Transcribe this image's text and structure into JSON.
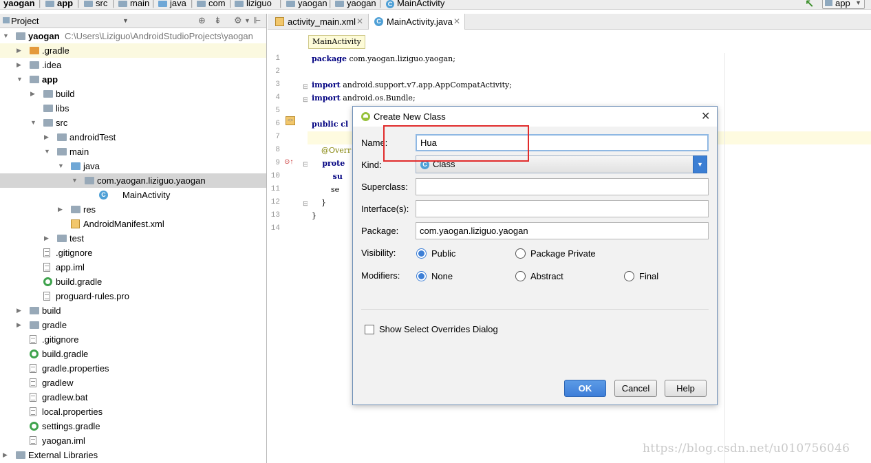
{
  "breadcrumb": {
    "items": [
      "yaogan",
      "app",
      "src",
      "main",
      "java",
      "com",
      "liziguo",
      "yaogan",
      "MainActivity"
    ],
    "run_config": "app"
  },
  "project_panel": {
    "title": "Project",
    "tree": [
      {
        "label": "yaogan",
        "path": "C:\\Users\\Liziguo\\AndroidStudioProjects\\yaogan",
        "depth": 0,
        "icon": "folder-icon",
        "expanded": true,
        "bold": true
      },
      {
        "label": ".gradle",
        "depth": 1,
        "icon": "orange-folder-icon",
        "expanded": false
      },
      {
        "label": ".idea",
        "depth": 1,
        "icon": "folder-icon",
        "expanded": false
      },
      {
        "label": "app",
        "depth": 1,
        "icon": "module-folder-icon",
        "expanded": true,
        "bold": true
      },
      {
        "label": "build",
        "depth": 2,
        "icon": "folder-icon",
        "expanded": false
      },
      {
        "label": "libs",
        "depth": 2,
        "icon": "folder-icon"
      },
      {
        "label": "src",
        "depth": 2,
        "icon": "folder-icon",
        "expanded": true
      },
      {
        "label": "androidTest",
        "depth": 3,
        "icon": "folder-icon",
        "expanded": false
      },
      {
        "label": "main",
        "depth": 3,
        "icon": "folder-icon",
        "expanded": true
      },
      {
        "label": "java",
        "depth": 4,
        "icon": "blue-folder-icon",
        "expanded": true
      },
      {
        "label": "com.yaogan.liziguo.yaogan",
        "depth": 5,
        "icon": "package-icon",
        "expanded": true,
        "selected": true
      },
      {
        "label": "MainActivity",
        "depth": 6,
        "icon": "class-icon"
      },
      {
        "label": "res",
        "depth": 4,
        "icon": "folder-icon",
        "expanded": false
      },
      {
        "label": "AndroidManifest.xml",
        "depth": 4,
        "icon": "xml-file-icon"
      },
      {
        "label": "test",
        "depth": 3,
        "icon": "folder-icon",
        "expanded": false
      },
      {
        "label": ".gitignore",
        "depth": 2,
        "icon": "file-icon"
      },
      {
        "label": "app.iml",
        "depth": 2,
        "icon": "file-icon"
      },
      {
        "label": "build.gradle",
        "depth": 2,
        "icon": "gradle-icon"
      },
      {
        "label": "proguard-rules.pro",
        "depth": 2,
        "icon": "file-icon"
      },
      {
        "label": "build",
        "depth": 1,
        "icon": "folder-icon",
        "expanded": false
      },
      {
        "label": "gradle",
        "depth": 1,
        "icon": "folder-icon",
        "expanded": false
      },
      {
        "label": ".gitignore",
        "depth": 1,
        "icon": "file-icon"
      },
      {
        "label": "build.gradle",
        "depth": 1,
        "icon": "gradle-icon"
      },
      {
        "label": "gradle.properties",
        "depth": 1,
        "icon": "file-icon"
      },
      {
        "label": "gradlew",
        "depth": 1,
        "icon": "file-icon"
      },
      {
        "label": "gradlew.bat",
        "depth": 1,
        "icon": "file-icon"
      },
      {
        "label": "local.properties",
        "depth": 1,
        "icon": "file-icon"
      },
      {
        "label": "settings.gradle",
        "depth": 1,
        "icon": "gradle-icon"
      },
      {
        "label": "yaogan.iml",
        "depth": 1,
        "icon": "file-icon"
      },
      {
        "label": "External Libraries",
        "depth": 0,
        "icon": "library-icon",
        "expanded": false
      }
    ]
  },
  "editor": {
    "tabs": [
      {
        "label": "activity_main.xml",
        "active": false
      },
      {
        "label": "MainActivity.java",
        "active": true
      }
    ],
    "context_chip": "MainActivity",
    "line_numbers": [
      "1",
      "2",
      "3",
      "4",
      "5",
      "6",
      "7",
      "8",
      "9",
      "10",
      "11",
      "12",
      "13",
      "14"
    ],
    "code_lines": [
      {
        "kw": "package",
        "rest": " com.yaogan.liziguo.yaogan;"
      },
      {
        "kw": "",
        "rest": ""
      },
      {
        "kw": "import",
        "rest": " android.support.v7.app.AppCompatActivity;"
      },
      {
        "kw": "import",
        "rest": " android.os.Bundle;"
      },
      {
        "kw": "",
        "rest": ""
      },
      {
        "kw": "public cl",
        "rest": ""
      },
      {
        "kw": "",
        "rest": ""
      },
      {
        "kw": "",
        "rest": "    @Overr"
      },
      {
        "kw": "    prote",
        "rest": ""
      },
      {
        "kw": "        su",
        "rest": ""
      },
      {
        "kw": "",
        "rest": "        se"
      },
      {
        "kw": "",
        "rest": "    }"
      },
      {
        "kw": "",
        "rest": "}"
      },
      {
        "kw": "",
        "rest": ""
      }
    ],
    "watermark": "https://blog.csdn.net/u010756046"
  },
  "dialog": {
    "title": "Create New Class",
    "name_label": "Name:",
    "name_value": "Hua",
    "kind_label": "Kind:",
    "kind_value": "Class",
    "superclass_label": "Superclass:",
    "superclass_value": "",
    "interfaces_label": "Interface(s):",
    "interfaces_value": "",
    "package_label": "Package:",
    "package_value": "com.yaogan.liziguo.yaogan",
    "visibility_label": "Visibility:",
    "visibility_options": [
      "Public",
      "Package Private"
    ],
    "visibility_selected": "Public",
    "modifiers_label": "Modifiers:",
    "modifiers_options": [
      "None",
      "Abstract",
      "Final"
    ],
    "modifiers_selected": "None",
    "overrides_label": "Show Select Overrides Dialog",
    "overrides_checked": false,
    "ok_label": "OK",
    "cancel_label": "Cancel",
    "help_label": "Help"
  },
  "colors": {
    "accent": "#3d7fd6",
    "highlight_box": "#e12b2b",
    "selection": "#d5d5d5"
  }
}
